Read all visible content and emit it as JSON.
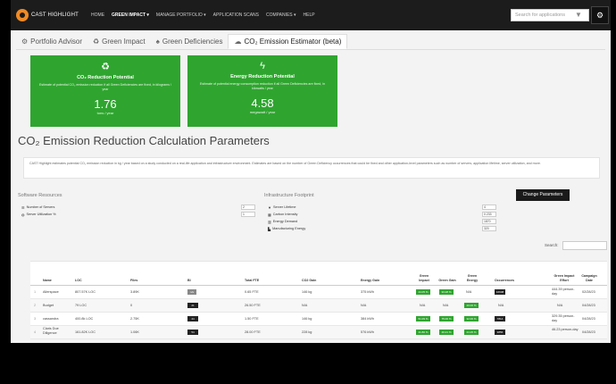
{
  "navbar": {
    "logo_text": "CAST HIGHLIGHT",
    "items": [
      {
        "label": "HOME"
      },
      {
        "label": "GREEN IMPACT ▾"
      },
      {
        "label": "MANAGE PORTFOLIO ▾"
      },
      {
        "label": "APPLICATION SCANS"
      },
      {
        "label": "COMPANIES ▾"
      },
      {
        "label": "HELP"
      }
    ],
    "search_placeholder": "Search for applications",
    "user_glyph": "⚙"
  },
  "tabs": [
    {
      "icon": "⚙",
      "label": "Portfolio Advisor"
    },
    {
      "icon": "♻",
      "label": "Green Impact"
    },
    {
      "icon": "♠",
      "label": "Green Deficiencies"
    },
    {
      "icon": "☁",
      "label": "CO₂ Emission Estimator (beta)"
    }
  ],
  "cards": [
    {
      "icon": "♻",
      "title": "CO₂ Reduction Potential",
      "desc": "Estimate of potential CO₂ emission reduction if all Green Deficiencies are fixed, in kilograms / year",
      "value": "1.76",
      "unit": "tons / year"
    },
    {
      "icon": "ϟ",
      "title": "Energy Reduction Potential",
      "desc": "Estimate of potential energy consumption reduction if all Green Deficiencies are fixed, in kilowatts / year",
      "value": "4.58",
      "unit": "megawatt / year"
    }
  ],
  "heading": "CO₂ Emission Reduction Calculation Parameters",
  "description": "CAST Highlight estimates potential CO₂ emission reduction in kg / year based on a study conducted on a real-life application and infrastructure environment. Estimates are based on the number of Green Deficiency occurrences that could be fixed and other application-level parameters such as number of servers, application lifetime, server utilization, and more.",
  "software_resources": {
    "title": "Software Resources",
    "params": [
      {
        "icon": "☰",
        "label": "Number of Servers",
        "value": "2"
      },
      {
        "icon": "◍",
        "label": "Server Utilization %",
        "value": "1"
      }
    ]
  },
  "infrastructure": {
    "title": "Infrastructure Footprint",
    "params": [
      {
        "icon": "▼",
        "label": "Server Lifetime",
        "value": "4"
      },
      {
        "icon": "▦",
        "label": "Carbon Intensity",
        "value": "0.233"
      },
      {
        "icon": "▥",
        "label": "Energy Demand",
        "value": "1870"
      },
      {
        "icon": "▙",
        "label": "Manufacturing Energy",
        "value": "320"
      }
    ]
  },
  "change_button": "Change Parameters",
  "search_label": "Search:",
  "table": {
    "columns": [
      {
        "label": "Name"
      },
      {
        "label": "LOC"
      },
      {
        "label": "Files"
      },
      {
        "label": "BI"
      },
      {
        "label": "Total FTE"
      },
      {
        "label": "CO2 Gain"
      },
      {
        "label": "Energy Gain"
      },
      {
        "label": "Green Impact"
      },
      {
        "label": "Green Gain"
      },
      {
        "label": "Green Energy"
      },
      {
        "label": "Occurrences"
      },
      {
        "label": "Green Impact Effort"
      },
      {
        "label": "Campaign Date"
      }
    ],
    "rows": [
      {
        "id": "1",
        "name": "Allerspace",
        "loc": "807.57K LOC",
        "files": "3.89K",
        "bi": "n/a",
        "fte": "0.65 FTE",
        "co2": "146 kg",
        "energy": "375 kWh",
        "impact": "44.05 %",
        "gain": "33.28 %",
        "genergy": "N/A",
        "occ": "16908",
        "effort": "444.39 person-day",
        "date": "02/28/23"
      },
      {
        "id": "2",
        "name": "Budget",
        "loc": "79 LOC",
        "files": "0",
        "bi": "21",
        "fte": "26.50 FTE",
        "co2": "N/A",
        "energy": "N/A",
        "impact": "N/A",
        "gain": "N/A",
        "genergy": "20.00 %",
        "occ": "N/A",
        "effort": "N/A",
        "date": "04/28/23"
      },
      {
        "id": "3",
        "name": "cassandra",
        "loc": "400.8k LOC",
        "files": "2.75K",
        "bi": "44",
        "fte": "1.50 FTE",
        "co2": "146 kg",
        "energy": "384 kWh",
        "impact": "51.09 %",
        "gain": "75.00 %",
        "genergy": "32.00 %",
        "occ": "7814",
        "effort": "329.35 person-day",
        "date": "04/28/23"
      },
      {
        "id": "4",
        "name": "Claris Due Diligence",
        "loc": "161.82K LOC",
        "files": "1.06K",
        "bi": "54",
        "fte": "28.00 FTE",
        "co2": "228 kg",
        "energy": "576 kWh",
        "impact": "41.80 %",
        "gain": "40.21 %",
        "genergy": "24.25 %",
        "occ": "3856",
        "effort": "46.23 person-day",
        "date": "04/28/23"
      }
    ]
  },
  "colors": {
    "green": "#2fa52f",
    "dark": "#1c1c1c",
    "accent": "#f08a24"
  }
}
